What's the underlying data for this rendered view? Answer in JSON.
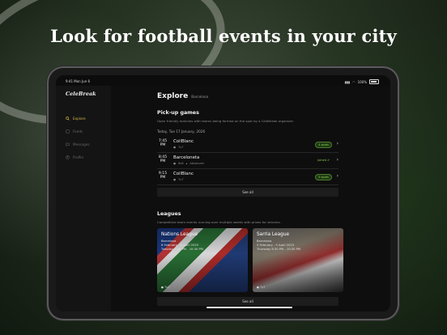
{
  "headline": "Look for football events in your city",
  "status_bar": {
    "time": "9:41",
    "date": "Mon Jun 6",
    "battery": "100%"
  },
  "sidebar": {
    "logo": "CeleBreak",
    "items": [
      {
        "label": "Explore",
        "icon": "search-icon",
        "active": true
      },
      {
        "label": "Feeds",
        "icon": "feed-icon",
        "active": false
      },
      {
        "label": "Messages",
        "icon": "chat-icon",
        "active": false
      },
      {
        "label": "Profile",
        "icon": "user-icon",
        "active": false
      }
    ]
  },
  "page": {
    "title": "Explore",
    "city": "Barcelona"
  },
  "pickup": {
    "title": "Pick-up games",
    "description": "Open friendly matches with teams being formed on the spot by a CeleBreak organizer.",
    "date_label": "Today, Tue 17 January, 2026",
    "games": [
      {
        "time": "7:45",
        "ampm": "PM",
        "name": "CollBlanc",
        "meta": "7v7",
        "meta2": "",
        "status": "4 spots"
      },
      {
        "time": "8:45",
        "ampm": "PM",
        "name": "Barceloneta",
        "meta": "6v6",
        "meta2": "Advanced",
        "status": "Joined"
      },
      {
        "time": "9:15",
        "ampm": "PM",
        "name": "CollBlanc",
        "meta": "7v7",
        "meta2": "",
        "status": "5 spots"
      }
    ],
    "see_all": "See all"
  },
  "leagues": {
    "title": "Leagues",
    "description": "Competitive team events running over multiple weeks with prizes for winners.",
    "cards": [
      {
        "name": "Nations League",
        "city": "Barcelona",
        "dates": "8 February - 8 April 2025",
        "days": "Tuesday 8:30 PM - 10:30 PM",
        "format": "7v7"
      },
      {
        "name": "Sarria League",
        "city": "Barcelona",
        "dates": "5 February - 5 April 2025",
        "days": "Thursday 8:30 PM - 10:30 PM",
        "format": "7v7"
      }
    ],
    "see_all": "See all"
  },
  "colors": {
    "accent": "#d4b64a",
    "spots_green": "#8bc94f",
    "background": "#0e0e0e"
  }
}
